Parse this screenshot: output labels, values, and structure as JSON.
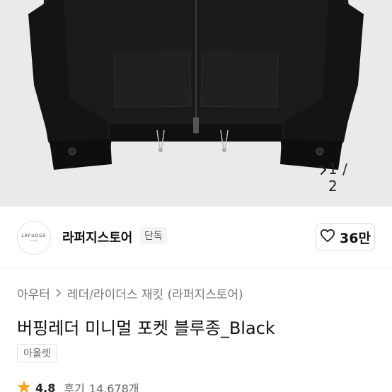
{
  "gallery": {
    "pager_text": "1 / 2",
    "icon_next": "chevron-right-icon"
  },
  "store": {
    "logo_text": "LAFUDGE",
    "logo_sub": "STORE",
    "name": "라퍼지스토어",
    "badge": "단독",
    "like_icon": "heart-outline-icon",
    "like_count": "36만"
  },
  "breadcrumb": {
    "items": [
      "아우터",
      "레더/라이더스 재킷 (라퍼지스토어)"
    ],
    "separator_icon": "chevron-right-icon"
  },
  "product": {
    "title": "버핑레더 미니멀 포켓 블루종_Black",
    "tag": "아울렛",
    "rating": "4.8",
    "review_label": "후기",
    "review_count": "14,678개"
  },
  "colors": {
    "star": "#f5a623",
    "background": "#ffffff",
    "image_bg": "#eceae9"
  }
}
